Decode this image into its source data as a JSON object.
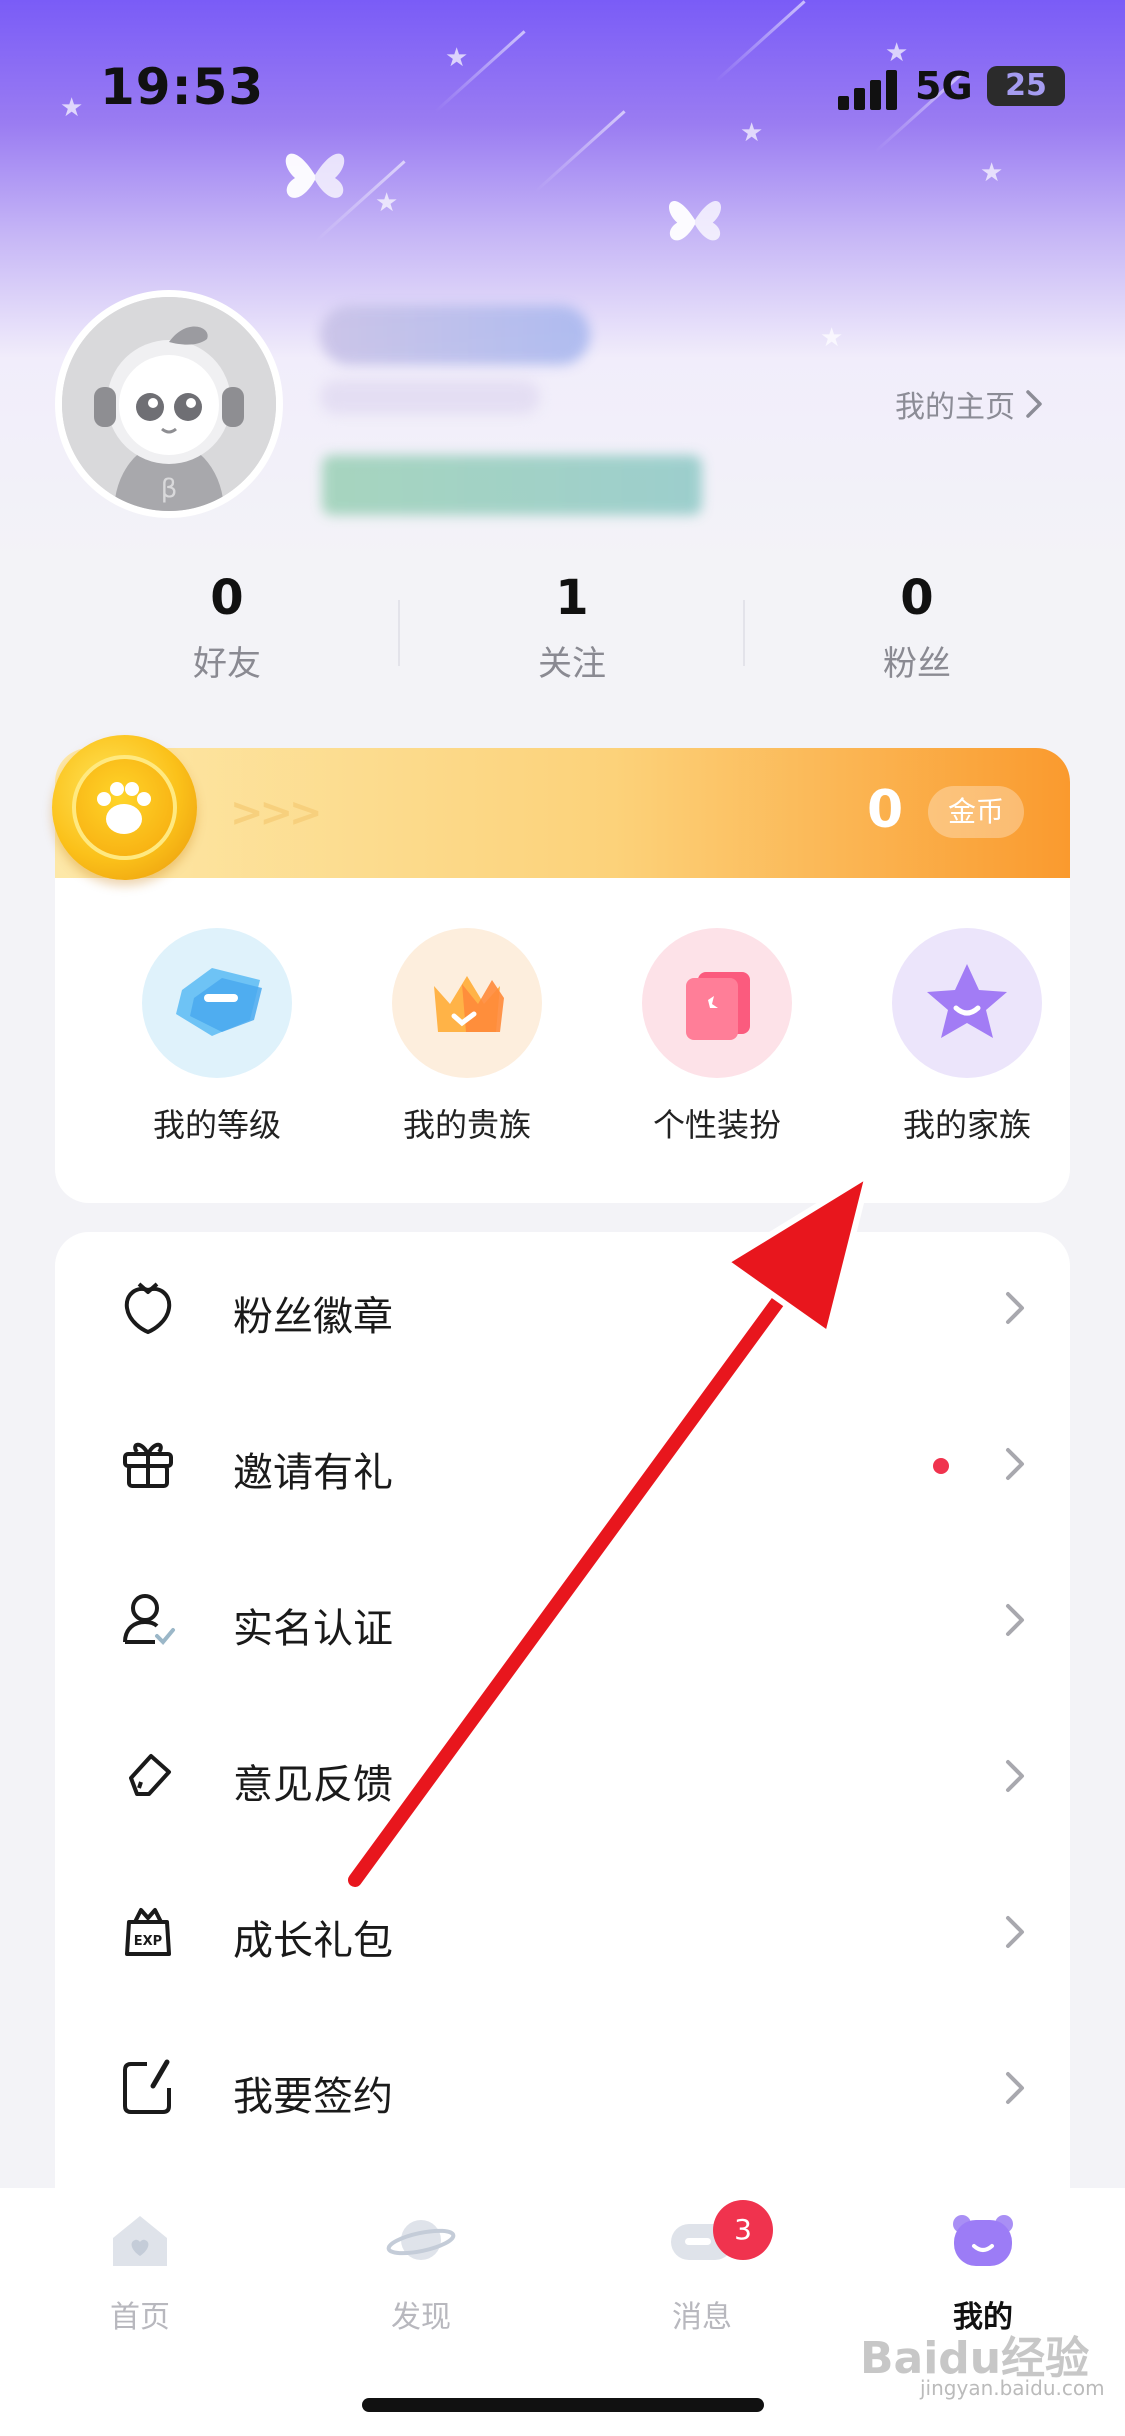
{
  "status_bar": {
    "time": "19:53",
    "network": "5G",
    "battery": "25"
  },
  "profile": {
    "homepage_link": "我的主页"
  },
  "stats": [
    {
      "value": "0",
      "label": "好友"
    },
    {
      "value": "1",
      "label": "关注"
    },
    {
      "value": "0",
      "label": "粉丝"
    }
  ],
  "coins": {
    "arrows": ">>>",
    "count": "0",
    "unit": "金币"
  },
  "features": [
    {
      "label": "我的等级",
      "icon": "level-gem-icon"
    },
    {
      "label": "我的贵族",
      "icon": "noble-crown-icon"
    },
    {
      "label": "个性装扮",
      "icon": "dress-up-card-icon"
    },
    {
      "label": "我的家族",
      "icon": "family-star-icon"
    }
  ],
  "menu": [
    {
      "label": "粉丝徽章",
      "icon": "fan-badge-icon",
      "has_dot": false
    },
    {
      "label": "邀请有礼",
      "icon": "gift-icon",
      "has_dot": true
    },
    {
      "label": "实名认证",
      "icon": "verified-user-icon",
      "has_dot": false
    },
    {
      "label": "意见反馈",
      "icon": "eraser-feedback-icon",
      "has_dot": false
    },
    {
      "label": "成长礼包",
      "icon": "exp-bag-icon",
      "has_dot": false
    },
    {
      "label": "我要签约",
      "icon": "sign-contract-icon",
      "has_dot": false
    }
  ],
  "tabbar": {
    "tabs": [
      {
        "label": "首页",
        "icon": "home-heart-icon",
        "active": false
      },
      {
        "label": "发现",
        "icon": "planet-icon",
        "active": false
      },
      {
        "label": "消息",
        "icon": "message-icon",
        "active": false
      },
      {
        "label": "我的",
        "icon": "mine-bear-icon",
        "active": true
      }
    ],
    "message_badge": "3"
  },
  "watermark": {
    "main": "Baidu经验",
    "sub": "jingyan.baidu.com"
  },
  "colors": {
    "accent_purple": "#7a5cf7",
    "coin_orange": "#fa9a2e",
    "badge_red": "#f0334e",
    "annotation_red": "#e8161d"
  }
}
